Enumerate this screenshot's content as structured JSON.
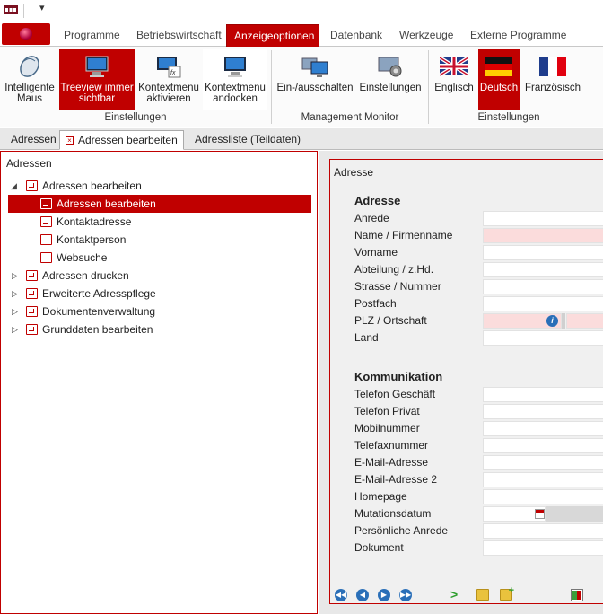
{
  "ribbon_tabs": [
    "Programme",
    "Betriebswirtschaft",
    "Anzeigeoptionen",
    "Datenbank",
    "Werkzeuge",
    "Externe Programme"
  ],
  "active_tab": "Anzeigeoptionen",
  "ribbon": {
    "buttons": [
      {
        "label": "Intelligente Maus",
        "icon": "mouse-icon"
      },
      {
        "label": "Treeview immer sichtbar",
        "icon": "monitor-icon"
      },
      {
        "label": "Kontextmenu aktivieren",
        "icon": "context-menu-icon"
      },
      {
        "label": "Kontextmenu andocken",
        "icon": "dock-icon"
      },
      {
        "label": "Ein-/ausschalten",
        "icon": "management-monitor-icon"
      },
      {
        "label": "Einstellungen",
        "icon": "monitor-settings-icon"
      },
      {
        "label": "Englisch",
        "icon": "uk-flag-icon"
      },
      {
        "label": "Deutsch",
        "icon": "german-flag-icon"
      },
      {
        "label": "Französisch",
        "icon": "french-flag-icon"
      }
    ],
    "groups": [
      "Einstellungen",
      "Management Monitor",
      "Einstellungen"
    ]
  },
  "doc_tabs": [
    "Adressen",
    "Adressen bearbeiten",
    "Adressliste (Teildaten)"
  ],
  "left_panel": {
    "title": "Adressen",
    "tree": [
      {
        "label": "Adressen bearbeiten",
        "level": 0,
        "expanded": true
      },
      {
        "label": "Adressen bearbeiten",
        "level": 1,
        "selected": true
      },
      {
        "label": "Kontaktadresse",
        "level": 1
      },
      {
        "label": "Kontaktperson",
        "level": 1
      },
      {
        "label": "Websuche",
        "level": 1
      },
      {
        "label": "Adressen drucken",
        "level": 0,
        "expanded": false
      },
      {
        "label": "Erweiterte Adresspflege",
        "level": 0,
        "expanded": false
      },
      {
        "label": "Dokumentenverwaltung",
        "level": 0,
        "expanded": false
      },
      {
        "label": "Grunddaten bearbeiten",
        "level": 0,
        "expanded": false
      }
    ]
  },
  "right_panel": {
    "title": "Adresse",
    "sections": [
      {
        "heading": "Adresse",
        "fields": [
          {
            "label": "Anrede",
            "value": "",
            "required": false
          },
          {
            "label": "Name / Firmenname",
            "value": "",
            "required": true
          },
          {
            "label": "Vorname",
            "value": "",
            "required": false
          },
          {
            "label": "Abteilung / z.Hd.",
            "value": "",
            "required": false
          },
          {
            "label": "Strasse / Nummer",
            "value": "",
            "required": false
          },
          {
            "label": "Postfach",
            "value": "",
            "required": false
          },
          {
            "label": "PLZ / Ortschaft",
            "value": "",
            "required": true
          },
          {
            "label": "Land",
            "value": "",
            "required": false
          }
        ]
      },
      {
        "heading": "Kommunikation",
        "fields": [
          {
            "label": "Telefon Geschäft",
            "value": ""
          },
          {
            "label": "Telefon Privat",
            "value": ""
          },
          {
            "label": "Mobilnummer",
            "value": ""
          },
          {
            "label": "Telefaxnummer",
            "value": ""
          },
          {
            "label": "E-Mail-Adresse",
            "value": ""
          },
          {
            "label": "E-Mail-Adresse 2",
            "value": ""
          },
          {
            "label": "Homepage",
            "value": ""
          },
          {
            "label": "Mutationsdatum",
            "value": ""
          },
          {
            "label": "Persönliche Anrede",
            "value": ""
          },
          {
            "label": "Dokument",
            "value": ""
          }
        ]
      }
    ]
  },
  "colors": {
    "accent": "#c00000",
    "required_field": "#fbdcdc",
    "nav_blue": "#2a6fb8"
  }
}
